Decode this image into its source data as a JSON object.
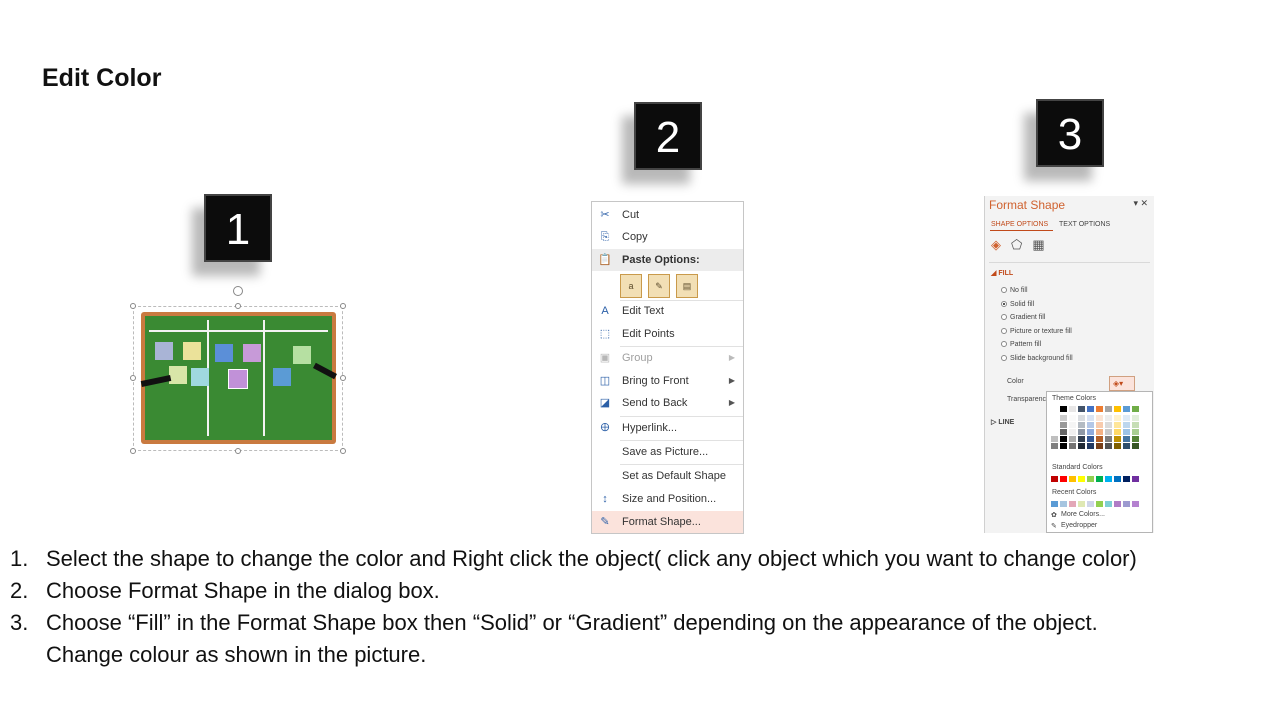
{
  "slide": {
    "title": "Edit Color"
  },
  "badges": [
    "1",
    "2",
    "3"
  ],
  "context_menu": {
    "items": [
      {
        "label": "Cut",
        "icon": "scissors-icon",
        "glyph": "✂",
        "enabled": true
      },
      {
        "label": "Copy",
        "icon": "copy-icon",
        "glyph": "⎘",
        "enabled": true
      },
      {
        "label": "Edit Text",
        "icon": "edit-text-icon",
        "glyph": "A",
        "enabled": true
      },
      {
        "label": "Edit Points",
        "icon": "edit-points-icon",
        "glyph": "⬚",
        "enabled": true
      },
      {
        "label": "Group",
        "icon": "group-icon",
        "glyph": "▣",
        "enabled": false
      },
      {
        "label": "Bring to Front",
        "icon": "bring-front-icon",
        "glyph": "◫",
        "enabled": true
      },
      {
        "label": "Send to Back",
        "icon": "send-back-icon",
        "glyph": "◪",
        "enabled": true
      },
      {
        "label": "Hyperlink...",
        "icon": "hyperlink-icon",
        "glyph": "🜨",
        "enabled": true
      },
      {
        "label": "Save as Picture...",
        "icon": "",
        "glyph": "",
        "enabled": true
      },
      {
        "label": "Set as Default Shape",
        "icon": "",
        "glyph": "",
        "enabled": true
      },
      {
        "label": "Size and Position...",
        "icon": "size-position-icon",
        "glyph": "↕",
        "enabled": true
      },
      {
        "label": "Format Shape...",
        "icon": "format-shape-icon",
        "glyph": "✎",
        "enabled": true
      }
    ],
    "paste_options_label": "Paste Options:",
    "paste_icon_glyphs": [
      "a",
      "✎",
      "▤"
    ],
    "paste_icon": "clipboard-icon",
    "paste_glyph": "📋",
    "submenu_arrow": "▶"
  },
  "format_panel": {
    "title": "Format Shape",
    "controls": "▾ ✕",
    "tabs": [
      "SHAPE OPTIONS",
      "TEXT OPTIONS"
    ],
    "icon_glyphs": [
      "◈",
      "⬠",
      "▦"
    ],
    "fill_section": "FILL",
    "fill_options": [
      "No fill",
      "Solid fill",
      "Gradient fill",
      "Picture or texture fill",
      "Pattern fill",
      "Slide background fill"
    ],
    "selected_fill": "Solid fill",
    "color_label": "Color",
    "color_button_glyph": "◈▾",
    "transparency_label": "Transparenc",
    "line_section": "LINE",
    "section_arrow_open": "◢",
    "section_arrow_closed": "▷"
  },
  "palette": {
    "theme_label": "Theme Colors",
    "standard_label": "Standard Colors",
    "recent_label": "Recent Colors",
    "more_colors": "More Colors...",
    "eyedropper": "Eyedropper",
    "more_colors_glyph": "✿",
    "eyedropper_glyph": "✎",
    "theme_colors": [
      "#ffffff",
      "#000000",
      "#e7e6e6",
      "#44546a",
      "#4472c4",
      "#ed7d31",
      "#a5a5a5",
      "#ffc000",
      "#5b9bd5",
      "#70ad47"
    ],
    "standard_colors": [
      "#c00000",
      "#ff0000",
      "#ffc000",
      "#ffff00",
      "#92d050",
      "#00b050",
      "#00b0f0",
      "#0070c0",
      "#002060",
      "#7030a0"
    ],
    "recent_colors": [
      "#5b9bd5",
      "#a6c5e0",
      "#e3a7b7",
      "#dfe8b4",
      "#cfd5ea",
      "#92d050",
      "#7fcfd5",
      "#b07cc6",
      "#9d9ad0",
      "#b582d0"
    ]
  },
  "instructions": [
    {
      "num": "1.",
      "text": "Select the shape to change the color and Right click the object( click any object which you want to change color)"
    },
    {
      "num": "2.",
      "text": "Choose Format Shape in the dialog box."
    },
    {
      "num": "3.",
      "text": "Choose “Fill” in the Format Shape box then “Solid” or “Gradient” depending on the appearance of the object. Change colour as shown in the picture."
    }
  ],
  "step1_picture": {
    "notes": [
      "#a9b4d6",
      "#ebe29a",
      "#5b8fd8",
      "#c79ad8",
      "#b6e0a2",
      "#d8e6a8",
      "#9fd8e0",
      "#c191d8",
      "#5b9bd5"
    ]
  }
}
